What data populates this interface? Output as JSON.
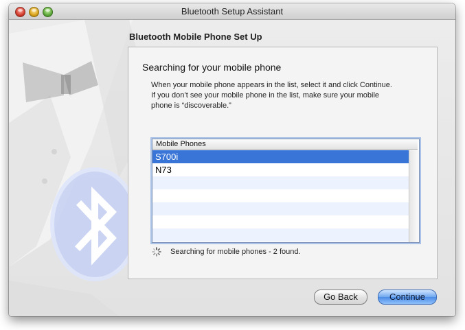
{
  "window": {
    "title": "Bluetooth Setup Assistant"
  },
  "page": {
    "heading": "Bluetooth Mobile Phone Set Up",
    "search_title": "Searching for your mobile phone",
    "description": "When your mobile phone appears in the list, select it and click Continue.\nIf you don’t see your mobile phone in the list, make sure your mobile\nphone is “discoverable.”"
  },
  "list": {
    "header": "Mobile Phones",
    "items": [
      {
        "label": "S700i",
        "selected": true
      },
      {
        "label": "N73",
        "selected": false
      }
    ],
    "empty_rows": 5
  },
  "status": {
    "text": "Searching for mobile phones - 2 found."
  },
  "buttons": {
    "back_label": "Go Back",
    "continue_label": "Continue"
  },
  "icons": {
    "window_close": "close-icon",
    "window_minimize": "minimize-icon",
    "window_zoom": "zoom-icon",
    "spinner": "spinner-icon",
    "bluetooth": "bluetooth-icon"
  },
  "colors": {
    "selection": "#3875d7",
    "default_button": "#4b8ce6",
    "alt_row": "#edf3fe"
  }
}
